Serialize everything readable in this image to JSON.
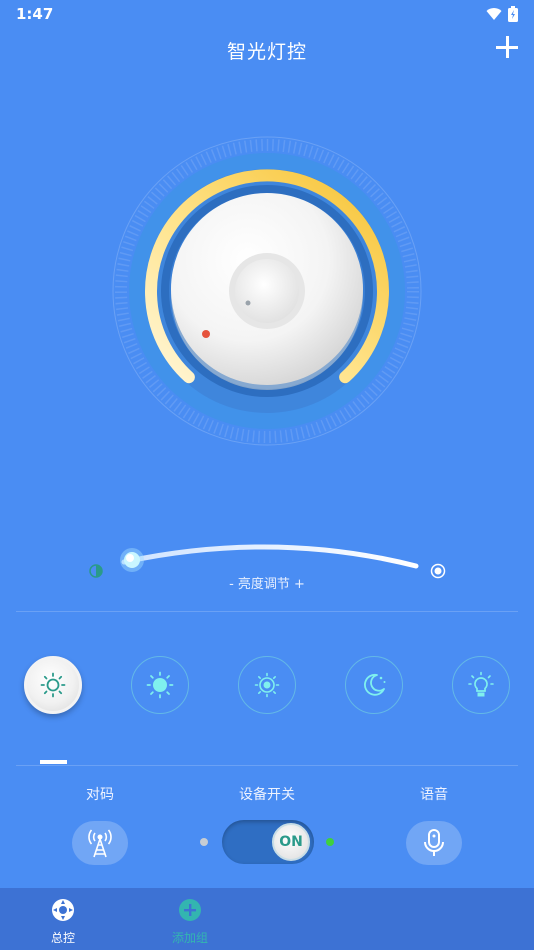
{
  "status": {
    "time": "1:47"
  },
  "header": {
    "title": "智光灯控"
  },
  "brightness": {
    "label": "- 亮度调节 +",
    "level_percent": 3
  },
  "scenes": [
    {
      "name": "sun-dim",
      "active": true
    },
    {
      "name": "sun-bright",
      "active": false
    },
    {
      "name": "sun-small",
      "active": false
    },
    {
      "name": "moon",
      "active": false
    },
    {
      "name": "bulb",
      "active": false
    }
  ],
  "controls": {
    "pair_label": "对码",
    "power_label": "设备开关",
    "voice_label": "语音",
    "power_state": "ON"
  },
  "nav": {
    "master_label": "总控",
    "add_group_label": "添加组"
  },
  "colors": {
    "background": "#4a8df3",
    "nav_bg": "#3d72d4",
    "accent_teal": "#2a9a8a",
    "arc_yellow": "#f7c842"
  }
}
